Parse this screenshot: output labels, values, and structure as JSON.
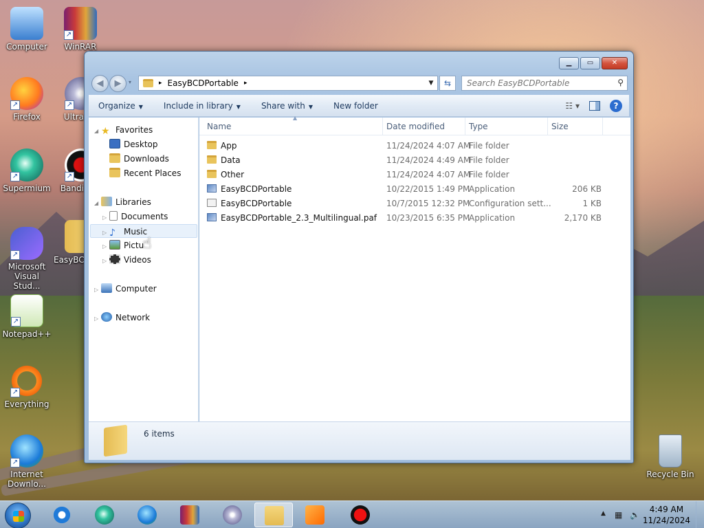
{
  "desktop": {
    "icons": [
      {
        "label": "Computer"
      },
      {
        "label": "WinRAR"
      },
      {
        "label": "Firefox"
      },
      {
        "label": "Ultra"
      },
      {
        "label": "Supermium"
      },
      {
        "label": "Bandi"
      },
      {
        "label": "Microsoft Visual Stud..."
      },
      {
        "label": "EasyBCD"
      },
      {
        "label": "Notepad++"
      },
      {
        "label": "Everything"
      },
      {
        "label": "Internet Downlo..."
      },
      {
        "label": "Recycle Bin"
      }
    ]
  },
  "window": {
    "address": {
      "segments": [
        "EasyBCDPortable"
      ],
      "arrow": "▸"
    },
    "search": {
      "placeholder": "Search EasyBCDPortable"
    },
    "toolbar": {
      "organize": "Organize",
      "include_in_library": "Include in library",
      "share_with": "Share with",
      "new_folder": "New folder"
    },
    "nav": {
      "favorites": "Favorites",
      "desktop": "Desktop",
      "downloads": "Downloads",
      "recent_places": "Recent Places",
      "libraries": "Libraries",
      "documents": "Documents",
      "music": "Music",
      "pictures": "Pictu",
      "videos": "Videos",
      "computer": "Computer",
      "network": "Network"
    },
    "columns": {
      "name": "Name",
      "date_modified": "Date modified",
      "type": "Type",
      "size": "Size"
    },
    "files": [
      {
        "name": "App",
        "date": "11/24/2024 4:07 AM",
        "type": "File folder",
        "size": "",
        "icon": "folder-icon"
      },
      {
        "name": "Data",
        "date": "11/24/2024 4:49 AM",
        "type": "File folder",
        "size": "",
        "icon": "folder-icon"
      },
      {
        "name": "Other",
        "date": "11/24/2024 4:07 AM",
        "type": "File folder",
        "size": "",
        "icon": "folder-icon"
      },
      {
        "name": "EasyBCDPortable",
        "date": "10/22/2015 1:49 PM",
        "type": "Application",
        "size": "206 KB",
        "icon": "application-icon"
      },
      {
        "name": "EasyBCDPortable",
        "date": "10/7/2015 12:32 PM",
        "type": "Configuration sett...",
        "size": "1 KB",
        "icon": "config-file-icon"
      },
      {
        "name": "EasyBCDPortable_2.3_Multilingual.paf",
        "date": "10/23/2015 6:35 PM",
        "type": "Application",
        "size": "2,170 KB",
        "icon": "application-icon"
      }
    ],
    "status": {
      "items_count": "6 items"
    }
  },
  "taskbar": {
    "clock_time": "4:49 AM",
    "clock_date": "11/24/2024"
  },
  "colors": {
    "accent": "#2b6ccf",
    "folder": "#e9c45c",
    "close": "#c33b25"
  }
}
